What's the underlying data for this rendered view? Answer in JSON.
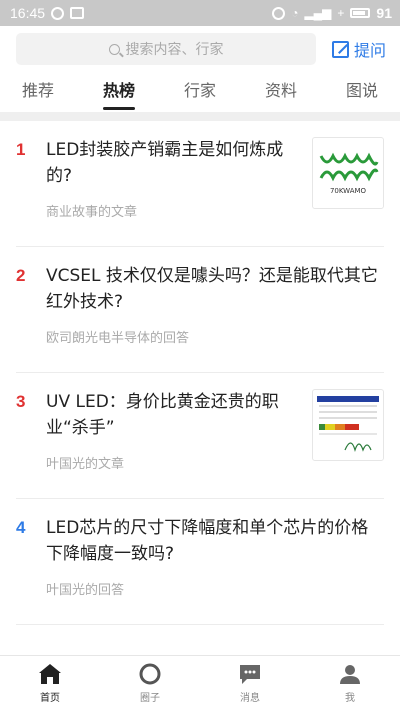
{
  "status_bar": {
    "time": "16:45",
    "battery": "91"
  },
  "search": {
    "placeholder": "搜索内容、行家",
    "ask_label": "提问"
  },
  "tabs": [
    {
      "label": "推荐",
      "active": false
    },
    {
      "label": "热榜",
      "active": true
    },
    {
      "label": "行家",
      "active": false
    },
    {
      "label": "资料",
      "active": false
    },
    {
      "label": "图说",
      "active": false
    }
  ],
  "items": [
    {
      "rank": "1",
      "rank_color": "#e03232",
      "title": "LED封装胶产销霸主是如何炼成的?",
      "meta": "商业故事的文章",
      "thumb_text": "70KWAMO"
    },
    {
      "rank": "2",
      "rank_color": "#e03232",
      "title": "VCSEL 技术仅仅是噱头吗？还是能取代其它红外技术?",
      "meta": "欧司朗光电半导体的回答"
    },
    {
      "rank": "3",
      "rank_color": "#e03232",
      "title": "UV LED：身价比黄金还贵的职业“杀手”",
      "meta": "叶国光的文章"
    },
    {
      "rank": "4",
      "rank_color": "#2e7be6",
      "title": "LED芯片的尺寸下降幅度和单个芯片的价格下降幅度一致吗?",
      "meta": "叶国光的回答"
    }
  ],
  "bottom_nav": [
    {
      "label": "首页",
      "icon": "home-icon",
      "active": true
    },
    {
      "label": "圈子",
      "icon": "circle-icon",
      "active": false
    },
    {
      "label": "消息",
      "icon": "message-icon",
      "active": false
    },
    {
      "label": "我",
      "icon": "user-icon",
      "active": false
    }
  ],
  "colors": {
    "accent": "#2e7be6",
    "rank_hot": "#e03232",
    "logo_green": "#2a9a3a"
  }
}
